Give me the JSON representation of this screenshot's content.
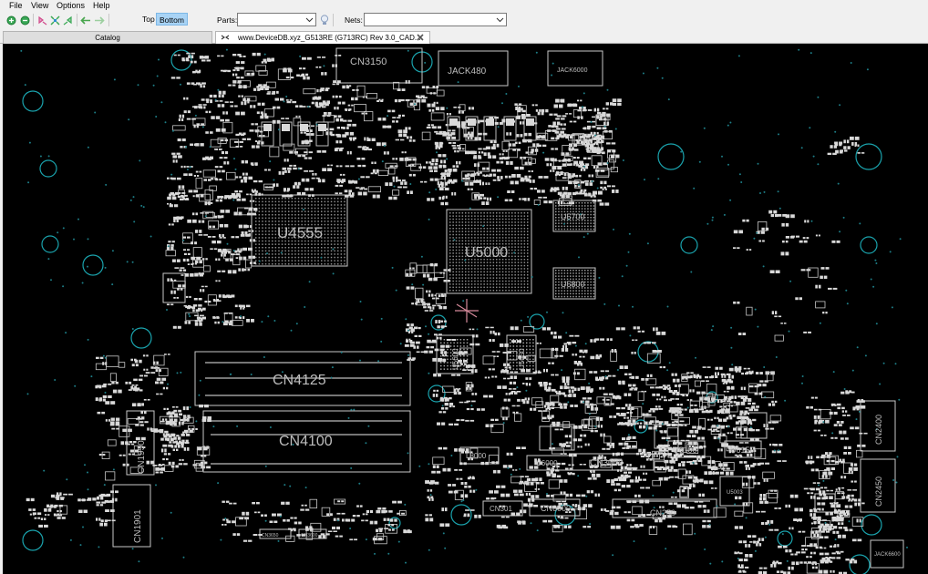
{
  "menu": {
    "items": [
      "File",
      "View",
      "Options",
      "Help"
    ]
  },
  "toolbar": {
    "side_top": "Top",
    "side_bottom": "Bottom",
    "parts_label": "Parts:",
    "parts_value": "",
    "nets_label": "Nets:",
    "nets_value": "",
    "active_side": "Bottom"
  },
  "tabs": {
    "catalog": "Catalog",
    "document": "www.DeviceDB.xyz_G513RE (G713RC) Rev 3.0_CAD..."
  },
  "board": {
    "labels": {
      "CN3150": "CN3150",
      "JACK480": "JACK480",
      "JACK6000": "JACK6000",
      "U4555": "U4555",
      "U5000": "U5000",
      "U5700": "U5700",
      "U5800": "U5800",
      "U5600": "U5600",
      "U5650": "U5650",
      "CN4125": "CN4125",
      "CN4100": "CN4100",
      "CN1950": "CN1950",
      "CN1901": "CN1901",
      "CN3000": "CN3000",
      "CN301": "CN301",
      "CN6000": "CN6000",
      "CN250": "CN250",
      "U6100": "U6100",
      "U6150": "U6150",
      "U6000": "U6000",
      "L8000": "L8000",
      "CN2400": "CN2400",
      "CN2450": "CN2450",
      "JACK6600": "JACK6600",
      "U5003": "U5003",
      "CN3650": "CN3650",
      "CN3600": "CN3600"
    }
  },
  "colors": {
    "board_bg": "#000000",
    "silk": "#bdbdbd",
    "pad": "#d9d9d9",
    "via": "#1d7d86",
    "hole": "#1aa3ad",
    "selected_btn": "#a8d3f5"
  }
}
